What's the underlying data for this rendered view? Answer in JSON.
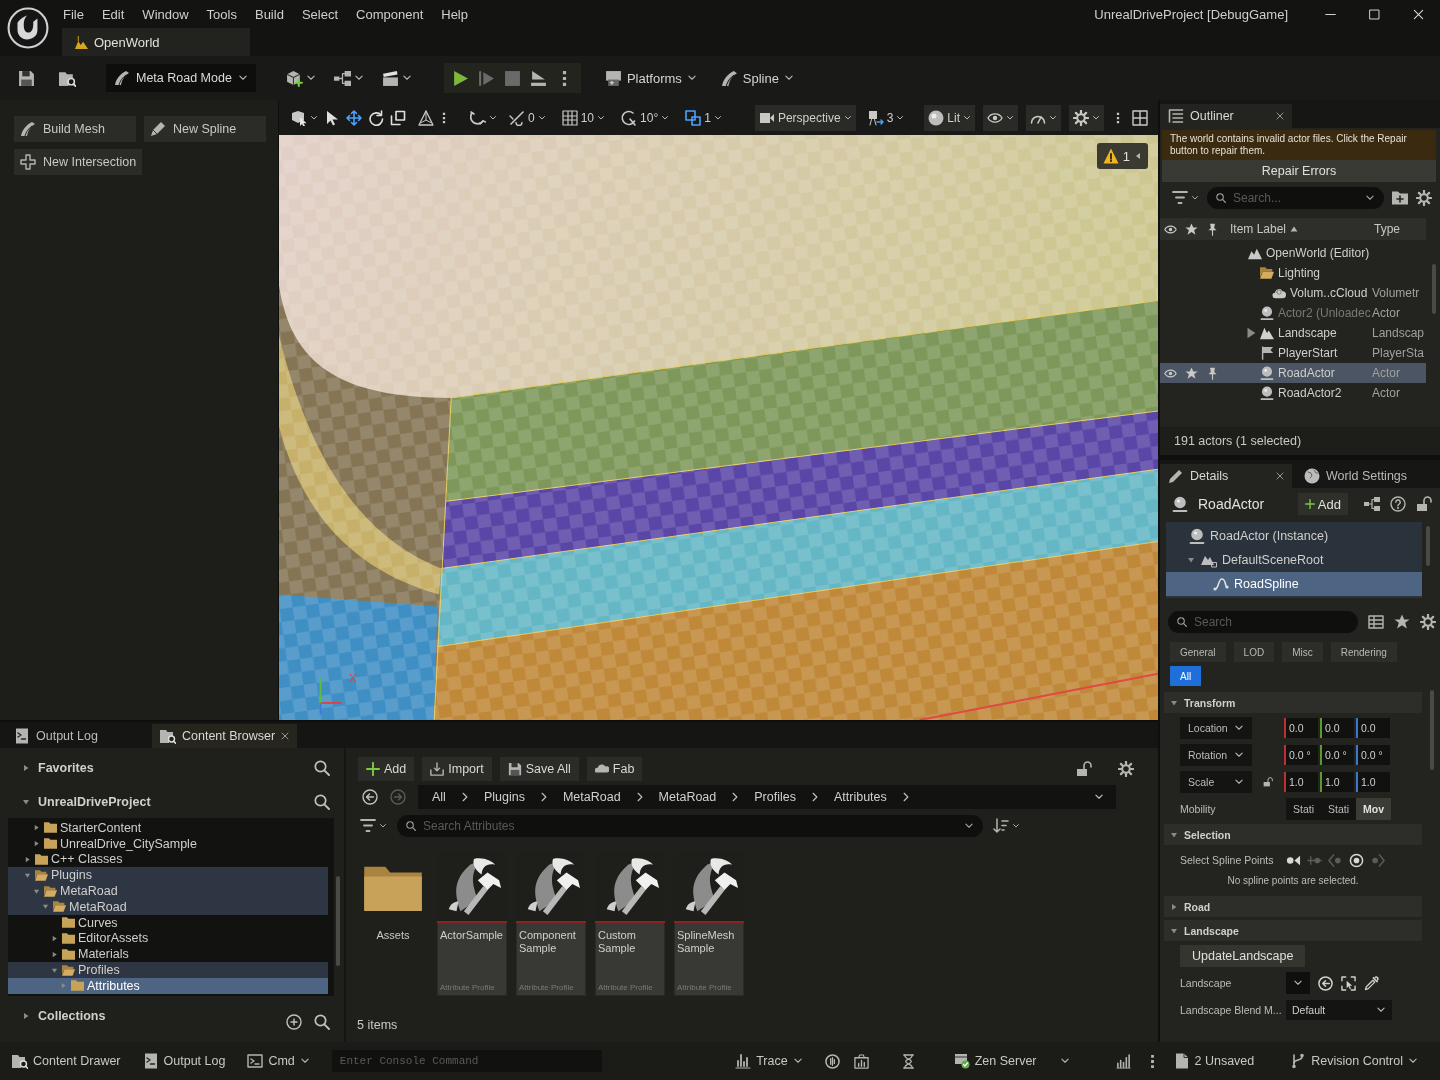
{
  "title_bar": {
    "menu": [
      "File",
      "Edit",
      "Window",
      "Tools",
      "Build",
      "Select",
      "Component",
      "Help"
    ],
    "level_tab": "OpenWorld",
    "project_title": "UnrealDriveProject [DebugGame]"
  },
  "main_toolbar": {
    "mode": "Meta Road Mode",
    "platforms": "Platforms",
    "spline": "Spline"
  },
  "mode_panel": {
    "buttons": [
      {
        "label": "Build Mesh",
        "kind": "build_mesh"
      },
      {
        "label": "New Spline",
        "kind": "new_spline"
      },
      {
        "label": "New Intersection",
        "kind": "new_intersection"
      }
    ]
  },
  "viewport": {
    "tools": [
      {
        "kind": "select",
        "selected": false
      },
      {
        "kind": "move",
        "selected": true
      },
      {
        "kind": "rotate",
        "selected": false
      },
      {
        "kind": "scale",
        "selected": false
      }
    ],
    "surface_snap": "0",
    "grid_snap": "10",
    "rotation_snap": "10°",
    "scale_snap": "1",
    "camera": "Perspective",
    "camera_speed": "3",
    "view_mode": "Lit",
    "warning_count": "1",
    "axis_label": "X"
  },
  "outliner": {
    "tab": "Outliner",
    "message": "The world contains invalid actor files. Click the Repair button to repair them.",
    "repair_button": "Repair Errors",
    "search": {
      "placeholder": "Search..."
    },
    "columns": [
      "Item Label",
      "Type"
    ],
    "rows": [
      {
        "label": "OpenWorld (Editor)",
        "kind": "world",
        "selected": false,
        "unloaded": false,
        "children": [
          {
            "label": "Lighting",
            "kind": "folder",
            "expanded": true,
            "selected": false,
            "unloaded": false,
            "children": [
              {
                "label": "Volum..cCloud",
                "type": "Volumetr",
                "kind": "cloud",
                "selected": false,
                "unloaded": false
              }
            ]
          },
          {
            "label": "Actor2 (Unloadec",
            "type": "Actor",
            "kind": "actor",
            "selected": false,
            "unloaded": true
          },
          {
            "label": "Landscape",
            "type": "Landscap",
            "kind": "landscape",
            "expanded": false,
            "selected": false,
            "unloaded": false
          },
          {
            "label": "PlayerStart",
            "type": "PlayerSta",
            "kind": "player_start",
            "selected": false,
            "unloaded": false
          },
          {
            "label": "RoadActor",
            "type": "Actor",
            "kind": "actor",
            "selected": true,
            "unloaded": false
          },
          {
            "label": "RoadActor2",
            "type": "Actor",
            "kind": "actor",
            "selected": false,
            "unloaded": false
          }
        ]
      }
    ],
    "footer": "191 actors (1 selected)"
  },
  "details": {
    "tabs": [
      {
        "label": "Details",
        "kind": "details",
        "selected": true
      },
      {
        "label": "World Settings",
        "kind": "world_settings",
        "selected": false
      }
    ],
    "actor": "RoadActor",
    "add_button": "Add",
    "components": [
      {
        "label": "RoadActor (Instance)",
        "kind": "actor",
        "selected": false,
        "children": [
          {
            "label": "DefaultSceneRoot",
            "kind": "scene_root",
            "expanded": true,
            "selected": false,
            "children": [
              {
                "label": "RoadSpline",
                "kind": "spline",
                "selected": true
              }
            ]
          }
        ]
      }
    ],
    "search": {
      "placeholder": "Search"
    },
    "filters": [
      {
        "label": "General",
        "selected": false
      },
      {
        "label": "LOD",
        "selected": false
      },
      {
        "label": "Misc",
        "selected": false
      },
      {
        "label": "Rendering",
        "selected": false
      },
      {
        "label": "All",
        "selected": true
      }
    ],
    "transform": {
      "title": "Transform",
      "expanded": true,
      "rows": [
        {
          "label": "Location",
          "values": [
            "0.0",
            "0.0",
            "0.0"
          ]
        },
        {
          "label": "Rotation",
          "values": [
            "0.0 °",
            "0.0 °",
            "0.0 °"
          ]
        },
        {
          "label": "Scale",
          "values": [
            "1.0",
            "1.0",
            "1.0"
          ],
          "locked": false
        }
      ],
      "mobility": {
        "label": "Mobility",
        "options": [
          {
            "label": "Stati",
            "selected": false
          },
          {
            "label": "Stati",
            "selected": false
          },
          {
            "label": "Mov",
            "selected": true
          }
        ]
      }
    },
    "selection": {
      "title": "Selection",
      "expanded": true,
      "label": "Select Spline Points",
      "tools": [
        {
          "kind": "first",
          "disabled": false
        },
        {
          "kind": "add",
          "disabled": true
        },
        {
          "kind": "previous",
          "disabled": true
        },
        {
          "kind": "all",
          "disabled": false
        },
        {
          "kind": "next",
          "disabled": true
        }
      ],
      "message": "No spline points are selected."
    },
    "road": {
      "title": "Road",
      "expanded": false
    },
    "landscape": {
      "title": "Landscape",
      "expanded": true,
      "button": "UpdateLandscape",
      "landscape_label": "Landscape",
      "blend_label": "Landscape Blend M...",
      "blend_value": "Default"
    }
  },
  "content_browser": {
    "tabs": [
      {
        "label": "Output Log",
        "kind": "log",
        "selected": false
      },
      {
        "label": "Content Browser",
        "kind": "browser",
        "selected": true
      }
    ],
    "favorites": {
      "label": "Favorites",
      "expanded": false
    },
    "project": {
      "label": "UnrealDriveProject",
      "expanded": true,
      "tree": [
        {
          "children": [
            {
              "label": "StarterContent",
              "expanded": false,
              "selected": false
            },
            {
              "label": "UnrealDrive_CitySample",
              "expanded": false,
              "selected": false
            }
          ]
        },
        {
          "label": "C++ Classes",
          "expanded": false,
          "selected": false
        },
        {
          "label": "Plugins",
          "expanded": true,
          "selected": false,
          "children": [
            {
              "label": "MetaRoad",
              "expanded": true,
              "selected": false,
              "children": [
                {
                  "label": "MetaRoad",
                  "expanded": true,
                  "selected": false,
                  "children": [
                    {
                      "label": "Curves",
                      "selected": false
                    },
                    {
                      "label": "EditorAssets",
                      "expanded": false,
                      "selected": false
                    },
                    {
                      "label": "Materials",
                      "expanded": false,
                      "selected": false
                    },
                    {
                      "label": "Profiles",
                      "expanded": true,
                      "selected": false,
                      "children": [
                        {
                          "label": "Attributes",
                          "expanded": false,
                          "selected": true
                        }
                      ]
                    }
                  ]
                }
              ]
            }
          ]
        }
      ]
    },
    "collections": {
      "label": "Collections",
      "expanded": false
    },
    "toolbar": [
      {
        "label": "Add",
        "kind": "add"
      },
      {
        "label": "Import",
        "kind": "import"
      },
      {
        "label": "Save All",
        "kind": "save_all"
      },
      {
        "label": "Fab",
        "kind": "fab"
      }
    ],
    "path": [
      "All",
      "Plugins",
      "MetaRoad",
      "MetaRoad",
      "Profiles",
      "Attributes"
    ],
    "search": {
      "placeholder": "Search Attributes"
    },
    "assets": [
      {
        "name": "Assets",
        "kind": "folder"
      },
      {
        "name": "ActorSample",
        "type": "Attribute Profile",
        "kind": "profile"
      },
      {
        "name": "Component Sample",
        "type": "Attribute Profile",
        "kind": "profile"
      },
      {
        "name": "Custom Sample",
        "type": "Attribute Profile",
        "kind": "profile"
      },
      {
        "name": "SplineMesh Sample",
        "type": "Attribute Profile",
        "kind": "profile"
      }
    ],
    "count": "5 items"
  },
  "status_bar": {
    "content_drawer": "Content Drawer",
    "output_log": "Output Log",
    "cmd": "Cmd",
    "console": {
      "placeholder": "Enter Console Command"
    },
    "trace": "Trace",
    "zen_server": "Zen Server",
    "unsaved": "2 Unsaved",
    "revision_control": "Revision Control"
  }
}
